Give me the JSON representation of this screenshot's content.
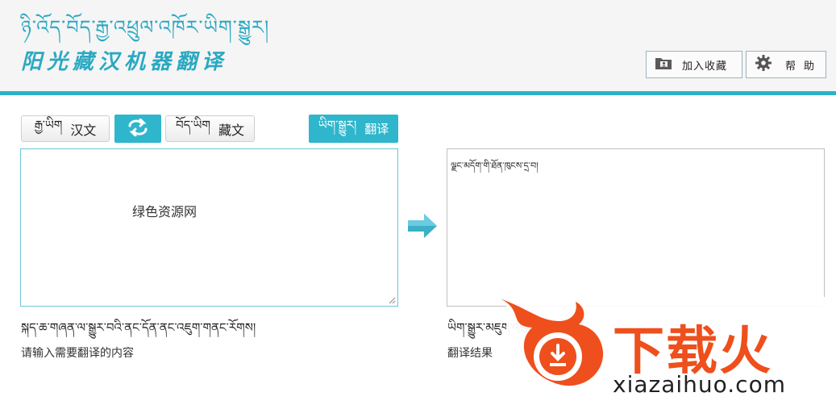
{
  "header": {
    "logo_tibetan": "ཉི་འོད་བོད་རྒྱ་འཕྲུལ་འཁོར་ཡིག་སྒྱུར།",
    "logo_chinese": "阳光藏汉机器翻译",
    "favorites_label": "加入收藏",
    "help_label": "帮助",
    "accent_color": "#29b3c8"
  },
  "toolbar": {
    "source_lang_tibetan": "རྒྱ་ཡིག",
    "source_lang_label": "汉文",
    "target_lang_tibetan": "བོད་ཡིག",
    "target_lang_label": "藏文",
    "swap_icon": "swap-arrows-icon",
    "translate_tibetan": "ཡིག་སྒྱུར།",
    "translate_label": "翻译"
  },
  "input": {
    "value": "绿色资源网",
    "hint_tibetan": "སྐད་ཆ་གཞན་ལ་སྒྱུར་བའི་ནང་དོན་ནང་འཇུག་གནང་རོགས།",
    "hint_chinese": "请输入需要翻译的内容"
  },
  "output": {
    "value": "ལྗང་མདོག་གི་ཐོན་ཁུངས་དྲ་བ།",
    "label_tibetan": "ཡིག་སྒྱུར་མཇུག་འབྲས།",
    "label_chinese": "翻译结果"
  },
  "watermark": {
    "brand": "下载火",
    "url": "xiazaihuo.com",
    "color": "#ee4f1c"
  }
}
